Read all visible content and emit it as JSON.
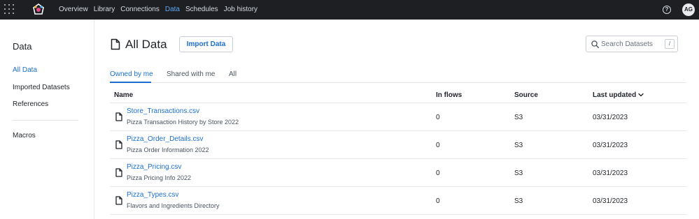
{
  "nav": {
    "items": [
      {
        "label": "Overview",
        "active": false
      },
      {
        "label": "Library",
        "active": false
      },
      {
        "label": "Connections",
        "active": false
      },
      {
        "label": "Data",
        "active": true
      },
      {
        "label": "Schedules",
        "active": false
      },
      {
        "label": "Job history",
        "active": false
      }
    ],
    "help_icon": "?",
    "avatar_initials": "AG"
  },
  "sidebar": {
    "title": "Data",
    "items": [
      {
        "label": "All Data",
        "active": true
      },
      {
        "label": "Imported Datasets",
        "active": false
      },
      {
        "label": "References",
        "active": false
      },
      {
        "label": "Macros",
        "active": false
      }
    ]
  },
  "main": {
    "title": "All Data",
    "import_label": "Import Data",
    "search": {
      "placeholder": "Search Datasets",
      "shortcut": "/"
    },
    "tabs": [
      {
        "label": "Owned by me",
        "active": true
      },
      {
        "label": "Shared with me",
        "active": false
      },
      {
        "label": "All",
        "active": false
      }
    ],
    "columns": {
      "name": "Name",
      "flows": "In flows",
      "source": "Source",
      "updated": "Last updated"
    },
    "rows": [
      {
        "name": "Store_Transactions.csv",
        "desc": "Pizza Transaction History by Store 2022",
        "flows": "0",
        "source": "S3",
        "updated": "03/31/2023"
      },
      {
        "name": "Pizza_Order_Details.csv",
        "desc": "Pizza Order Information 2022",
        "flows": "0",
        "source": "S3",
        "updated": "03/31/2023"
      },
      {
        "name": "Pizza_Pricing.csv",
        "desc": "Pizza Pricing Info 2022",
        "flows": "0",
        "source": "S3",
        "updated": "03/31/2023"
      },
      {
        "name": "Pizza_Types.csv",
        "desc": "Flavors and Ingredients Directory",
        "flows": "0",
        "source": "S3",
        "updated": "03/31/2023"
      }
    ]
  },
  "colors": {
    "accent": "#1b6fd1",
    "topbar": "#1d1f22",
    "nav_active": "#5ba8f5"
  }
}
